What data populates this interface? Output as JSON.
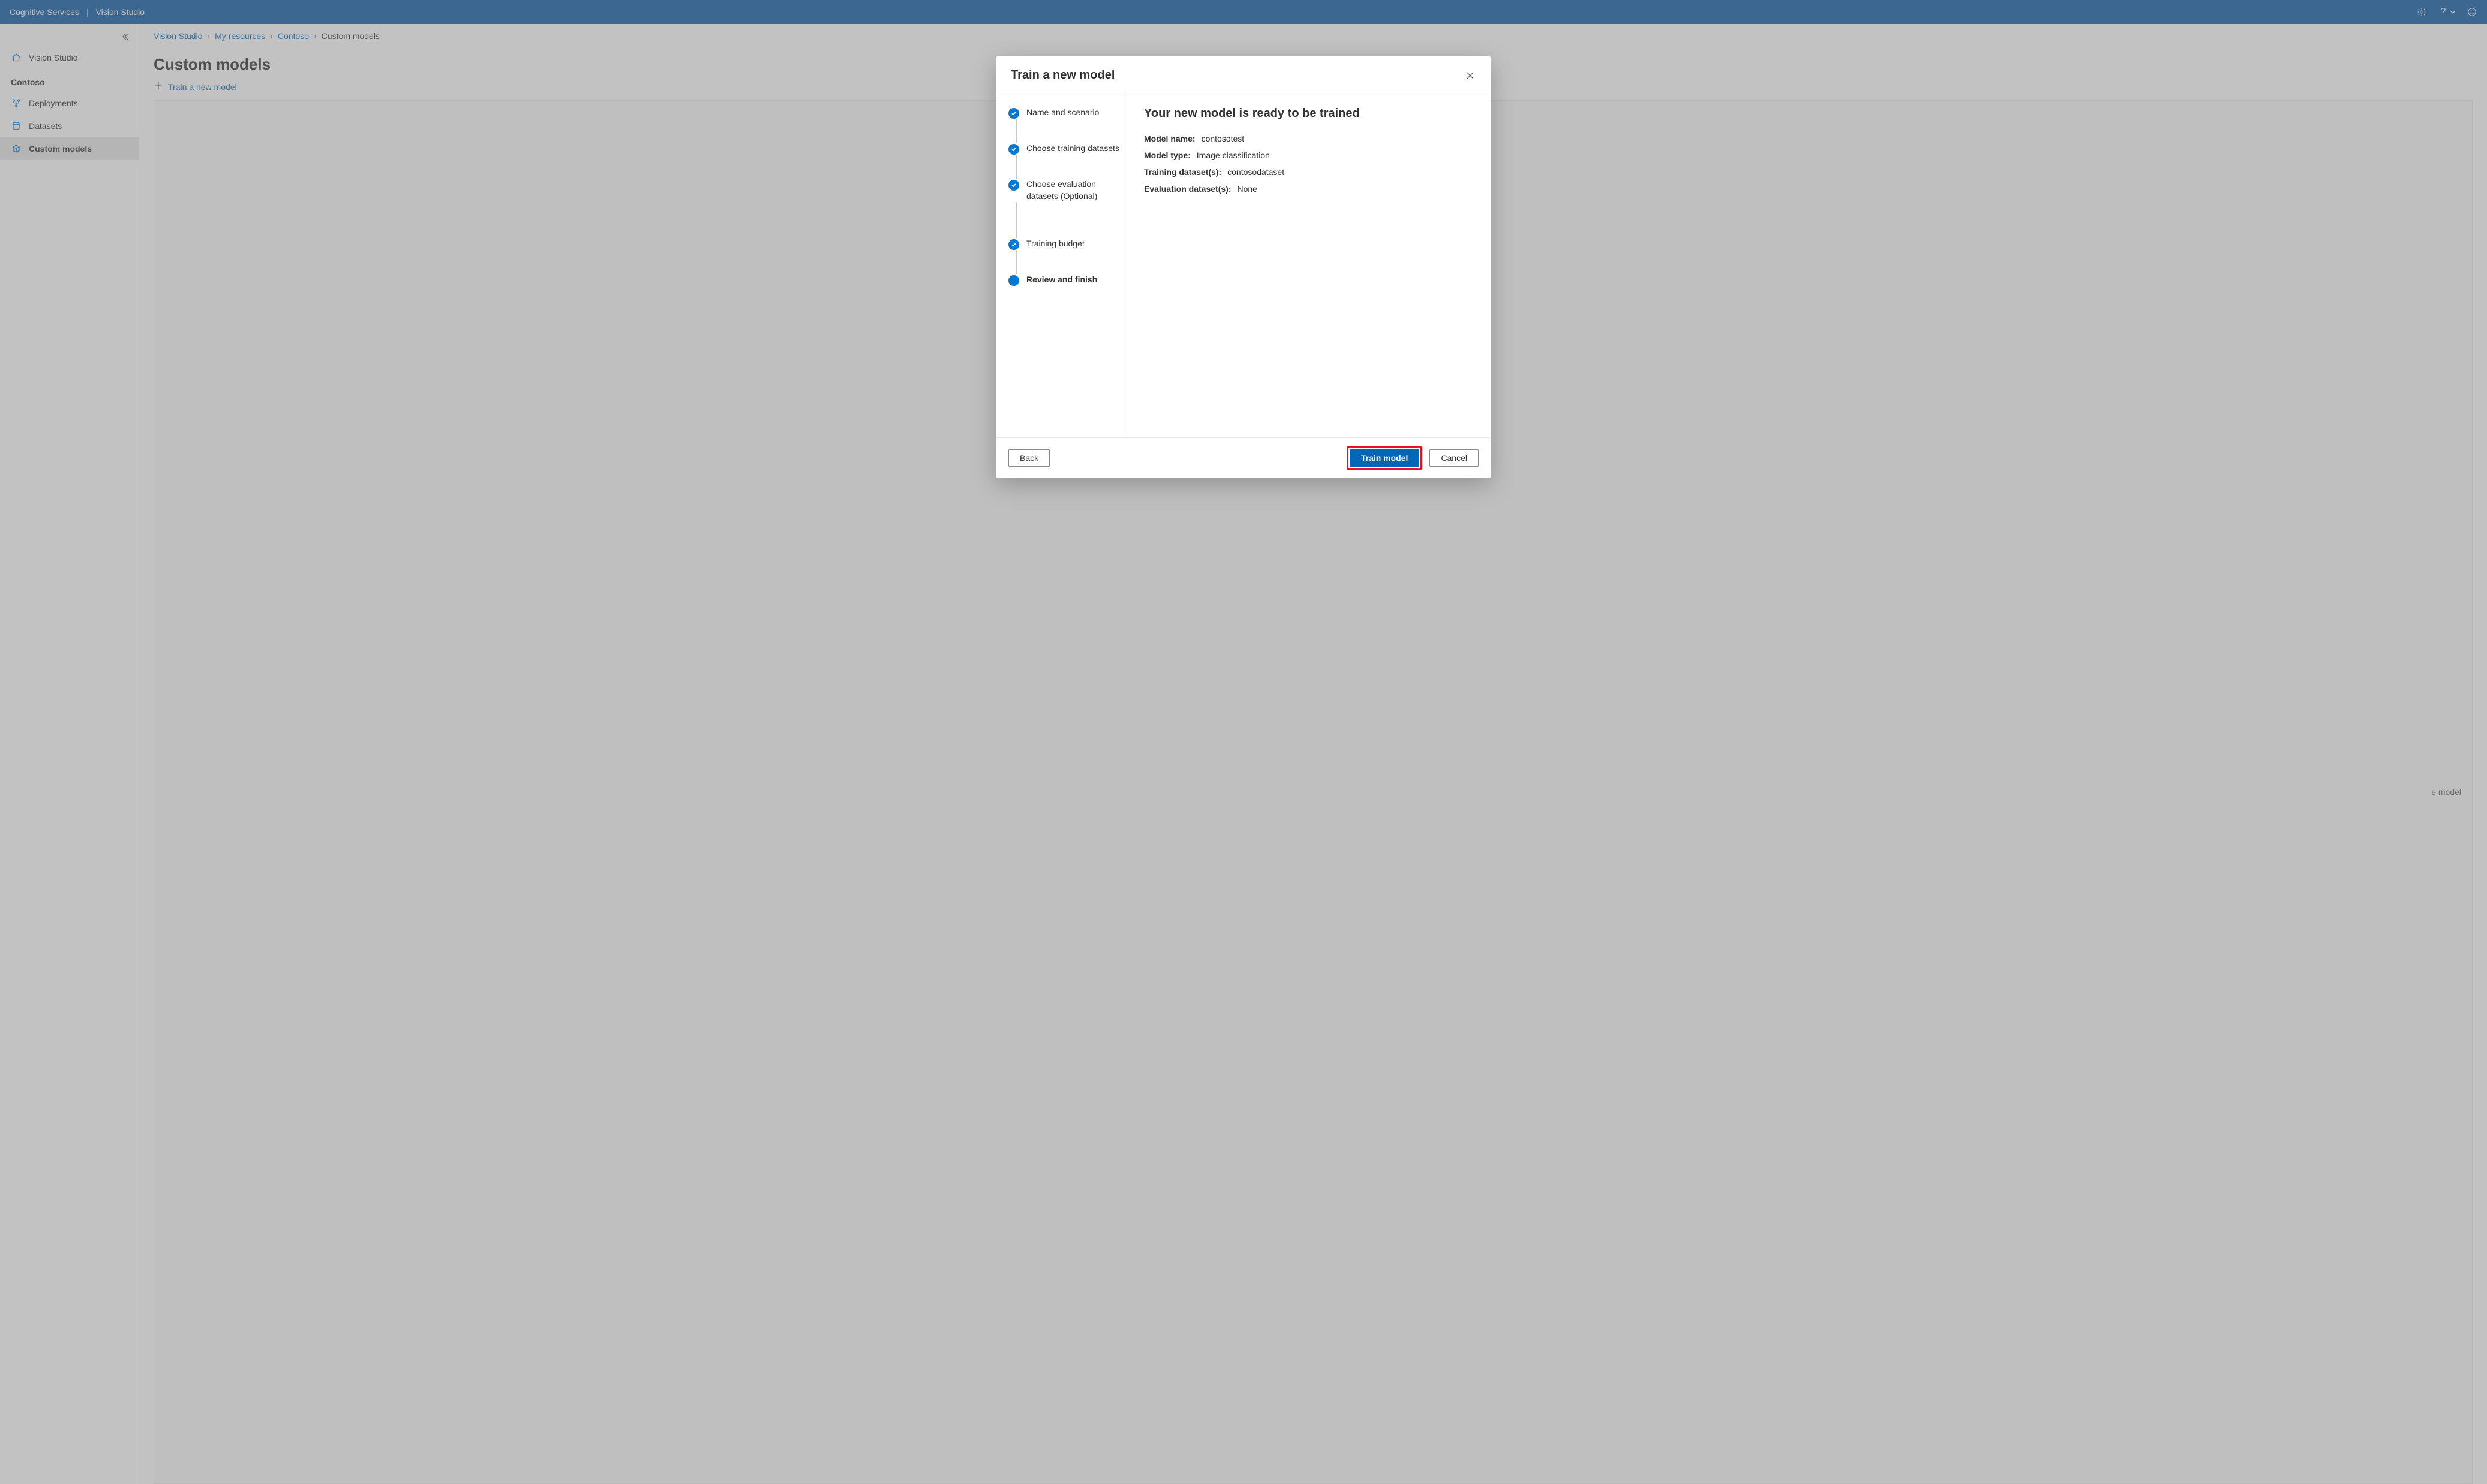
{
  "topbar": {
    "brand": "Cognitive Services",
    "product": "Vision Studio"
  },
  "sidebar": {
    "home": "Vision Studio",
    "section": "Contoso",
    "items": [
      {
        "label": "Deployments"
      },
      {
        "label": "Datasets"
      },
      {
        "label": "Custom models"
      }
    ]
  },
  "breadcrumbs": [
    "Vision Studio",
    "My resources",
    "Contoso",
    "Custom models"
  ],
  "page": {
    "title": "Custom models",
    "toolbar_add": "Train a new model",
    "hint_text": "e model"
  },
  "dialog": {
    "title": "Train a new model",
    "steps": [
      "Name and scenario",
      "Choose training datasets",
      "Choose evaluation datasets (Optional)",
      "Training budget",
      "Review and finish"
    ],
    "review": {
      "heading": "Your new model is ready to be trained",
      "rows": [
        {
          "key": "Model name:",
          "val": "contosotest"
        },
        {
          "key": "Model type:",
          "val": "Image classification"
        },
        {
          "key": "Training dataset(s):",
          "val": "contosodataset"
        },
        {
          "key": "Evaluation dataset(s):",
          "val": "None"
        }
      ]
    },
    "buttons": {
      "back": "Back",
      "train": "Train model",
      "cancel": "Cancel"
    }
  }
}
